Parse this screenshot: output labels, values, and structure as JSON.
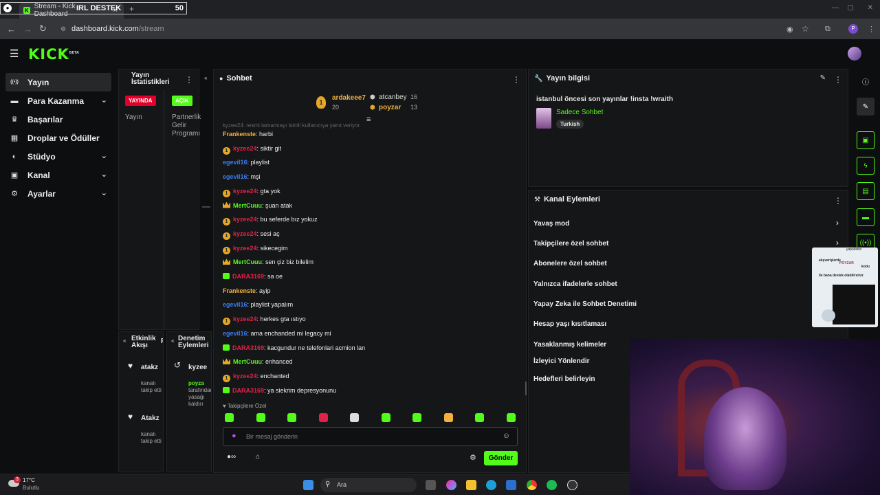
{
  "browser": {
    "overlay_label": "IRL DESTEK",
    "overlay_count": "50",
    "tab_title": "Stream - Kick Dashboard",
    "url_host": "dashboard.kick.com",
    "url_path": "/stream",
    "profile_initial": "P"
  },
  "app": {
    "logo": "KICK",
    "logo_beta": "BETA"
  },
  "sidebar": {
    "items": [
      {
        "label": "Yayın",
        "icon": "broadcast-icon",
        "active": true
      },
      {
        "label": "Para Kazanma",
        "icon": "money-icon",
        "expandable": true
      },
      {
        "label": "Başarılar",
        "icon": "trophy-icon"
      },
      {
        "label": "Droplar ve Ödüller",
        "icon": "gift-icon"
      },
      {
        "label": "Stüdyo",
        "icon": "palette-icon",
        "expandable": true
      },
      {
        "label": "Kanal",
        "icon": "channel-icon",
        "expandable": true
      },
      {
        "label": "Ayarlar",
        "icon": "gear-icon",
        "expandable": true
      }
    ]
  },
  "stats": {
    "title": "Yayın İstatistikleri",
    "live_badge": "YAYINDA",
    "live_label": "Yayın",
    "open_badge": "AÇIK",
    "partner_label": "Partnerlik Gelir Programı"
  },
  "activity": {
    "title": "Etkinlik Akışı",
    "tab_cut": "F",
    "events": [
      {
        "name": "atakz",
        "text": "kanalı takip etti"
      },
      {
        "name": "Atakz",
        "text": "kanalı takip etti"
      }
    ]
  },
  "mod_actions": {
    "title": "Denetim Eylemleri",
    "entry_name": "kyzee",
    "entry_actor": "poyza",
    "entry_text": "tarafından yasağı kaldırı"
  },
  "chat": {
    "title": "Sohbet",
    "leaderboard": [
      {
        "rank": "1",
        "name": "ardakeee7",
        "count": "20"
      },
      {
        "name": "atcanbey",
        "count": "16"
      },
      {
        "name": "poyzar",
        "count": "13"
      }
    ],
    "cut_message": "kyzee24: resmi tamamıayı isimli kullanıcıya yanıt veriyor",
    "messages": [
      {
        "user": "Frankenste",
        "text": "harbi",
        "color": "#f4b03f",
        "badge": "none"
      },
      {
        "user": "kyzee24",
        "text": "siktir git",
        "color": "#e0224a",
        "badge": "sub"
      },
      {
        "user": "egevil16",
        "text": "playlist",
        "color": "#3c7cf0",
        "badge": "none"
      },
      {
        "user": "egevil16",
        "text": "mşi",
        "color": "#3c7cf0",
        "badge": "none"
      },
      {
        "user": "kyzee24",
        "text": "gta yok",
        "color": "#e0224a",
        "badge": "sub"
      },
      {
        "user": "MertCuuu",
        "text": "şuan atak",
        "color": "#53fc18",
        "badge": "crown"
      },
      {
        "user": "kyzee24",
        "text": "bu seferde bız yokuz",
        "color": "#e0224a",
        "badge": "sub"
      },
      {
        "user": "kyzee24",
        "text": "sesi aç",
        "color": "#e0224a",
        "badge": "sub"
      },
      {
        "user": "kyzee24",
        "text": "sikecegim",
        "color": "#e0224a",
        "badge": "sub"
      },
      {
        "user": "MertCuuu",
        "text": "sen çiz biz bilelim",
        "color": "#53fc18",
        "badge": "crown"
      },
      {
        "user": "DARA3169",
        "text": "sa oe",
        "color": "#e0224a",
        "badge": "bot"
      },
      {
        "user": "Frankenste",
        "text": "ayip",
        "color": "#f4b03f",
        "badge": "none"
      },
      {
        "user": "egevil16",
        "text": "playlist yapalım",
        "color": "#3c7cf0",
        "badge": "none"
      },
      {
        "user": "kyzee24",
        "text": "herkes gta ıstıyo",
        "color": "#e0224a",
        "badge": "sub"
      },
      {
        "user": "egevil16",
        "text": "ama enchanded mi legacy mi",
        "color": "#3c7cf0",
        "badge": "none"
      },
      {
        "user": "DARA3169",
        "text": "kacgundur ne telefonlari acmion lan",
        "color": "#e0224a",
        "badge": "bot"
      },
      {
        "user": "MertCuuu",
        "text": "enhanced",
        "color": "#53fc18",
        "badge": "crown"
      },
      {
        "user": "kyzee24",
        "text": "enchanted",
        "color": "#e0224a",
        "badge": "sub"
      },
      {
        "user": "DARA3169",
        "text": "ya siekrim depresyonunu",
        "color": "#e0224a",
        "badge": "bot"
      }
    ],
    "followers_only": "Takipçilere Özel",
    "input_placeholder": "Bir mesaj gönderin",
    "send_label": "Gönder"
  },
  "stream_info": {
    "title": "Yayın bilgisi",
    "stream_title": "istanbul öncesi son yayınlar !insta !wraith",
    "category": "Sadece Sohbet",
    "language": "Turkish"
  },
  "channel_actions": {
    "title": "Kanal Eylemleri",
    "items": [
      "Yavaş mod",
      "Takipçilere özel sohbet",
      "Abonelere özel sohbet",
      "Yalnızca ifadelerle sohbet",
      "Yapay Zeka ile Sohbet Denetimi",
      "Hesap yaşı kısıtlaması",
      "Yasaklanmış kelimeler",
      "İzleyici Yönlendir",
      "Hedefleri belirleyin"
    ]
  },
  "overlay_ad": {
    "line1": "alışverişlerde",
    "code": "POYZAR",
    "line2": "kodu",
    "line3": "ile bana destek olabilirsiniz",
    "corner": "yapabiliriz"
  },
  "taskbar": {
    "temp": "17°C",
    "weather": "Bulutlu",
    "notif_count": "3",
    "search": "Ara"
  },
  "colors": {
    "accent": "#53fc18",
    "live": "#e1002a"
  }
}
